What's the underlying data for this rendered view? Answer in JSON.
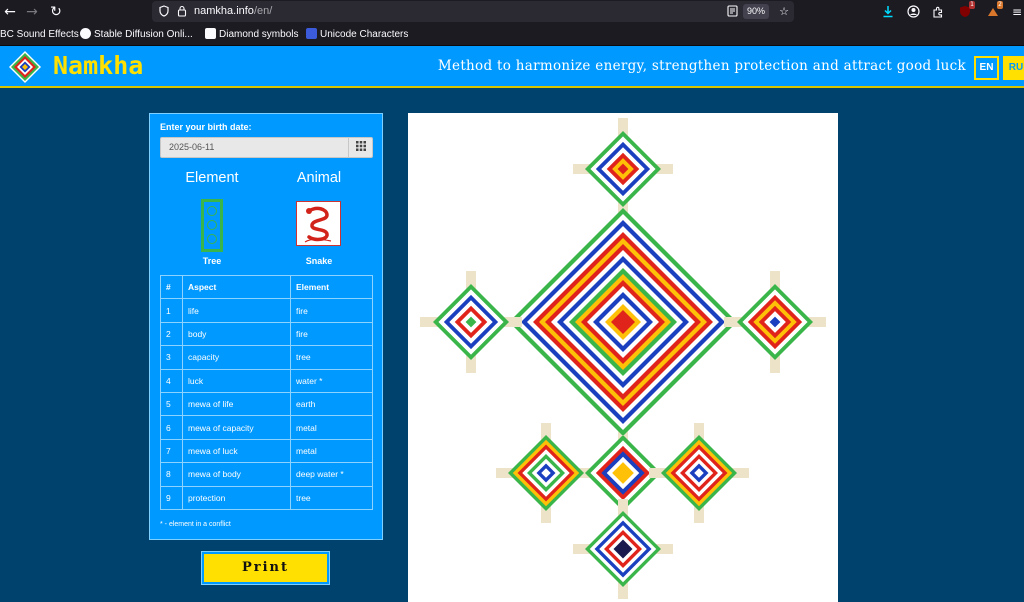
{
  "browser": {
    "url_domain": "namkha.info",
    "url_path": "/en/",
    "zoom": "90%",
    "bookmarks": [
      {
        "label": "BC Sound Effects"
      },
      {
        "label": "Stable Diffusion Onli..."
      },
      {
        "label": "Diamond symbols"
      },
      {
        "label": "Unicode Characters"
      }
    ]
  },
  "header": {
    "title": "Namkha",
    "tagline": "Method to harmonize energy, strengthen protection and attract good luck",
    "lang_en": "EN",
    "lang_ru": "RU"
  },
  "form": {
    "birth_label": "Enter your birth date:",
    "birth_date": "2025-06-11",
    "element_heading": "Element",
    "animal_heading": "Animal",
    "element_name": "Tree",
    "animal_name": "Snake"
  },
  "table": {
    "headers": [
      "#",
      "Aspect",
      "Element"
    ],
    "rows": [
      [
        "1",
        "life",
        "fire"
      ],
      [
        "2",
        "body",
        "fire"
      ],
      [
        "3",
        "capacity",
        "tree"
      ],
      [
        "4",
        "luck",
        "water *"
      ],
      [
        "5",
        "mewa of life",
        "earth"
      ],
      [
        "6",
        "mewa of capacity",
        "metal"
      ],
      [
        "7",
        "mewa of luck",
        "metal"
      ],
      [
        "8",
        "mewa of body",
        "deep water *"
      ],
      [
        "9",
        "protection",
        "tree"
      ]
    ],
    "note": "* - element in a conflict"
  },
  "print_label": "Print",
  "colors": {
    "page_bg": "#00426e",
    "header_bg": "#0099ff",
    "accent_yellow": "#ffe000",
    "tree_green": "#3ab54a",
    "fire_red": "#e0241b",
    "water_blue": "#1a3fbf",
    "earth_yellow": "#ffc107",
    "metal_white": "#ffffff",
    "deep_water": "#1a1a4e",
    "stick": "#ede3c8"
  }
}
